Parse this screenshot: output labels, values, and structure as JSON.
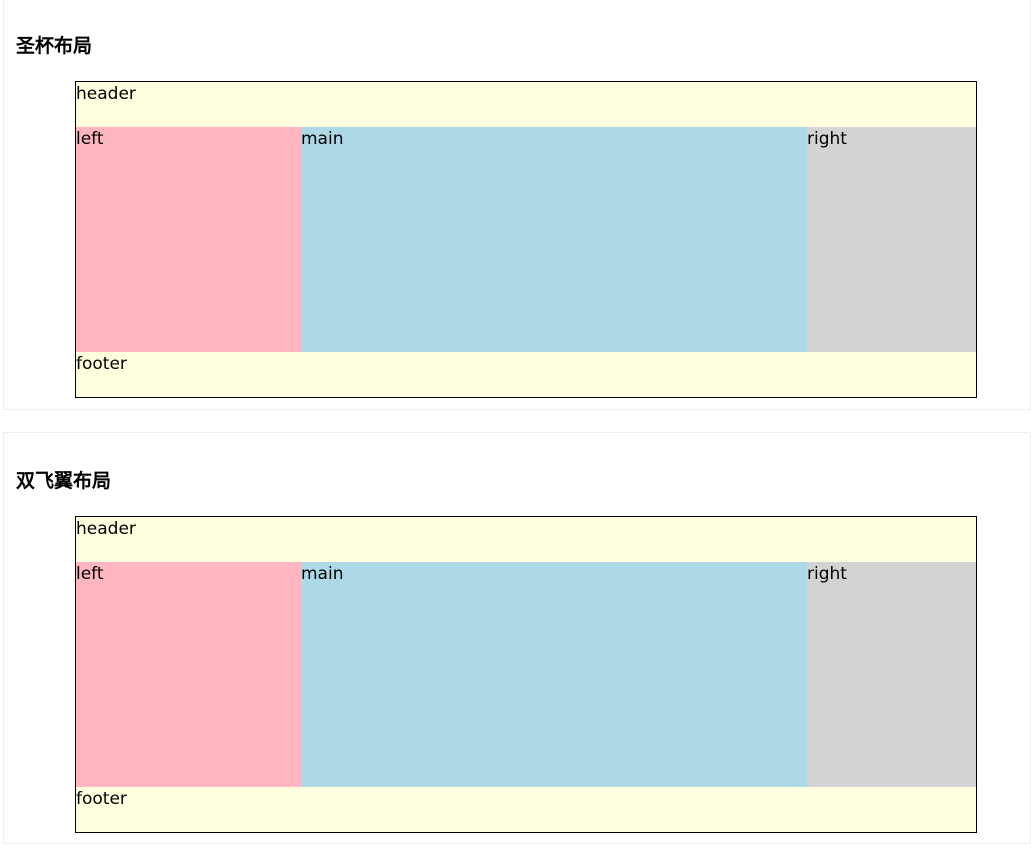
{
  "sections": [
    {
      "title": "圣杯布局",
      "regions": {
        "header": "header",
        "left": "left",
        "main": "main",
        "right": "right",
        "footer": "footer"
      }
    },
    {
      "title": "双飞翼布局",
      "regions": {
        "header": "header",
        "left": "left",
        "main": "main",
        "right": "right",
        "footer": "footer"
      }
    }
  ],
  "colors": {
    "header_footer": "#ffffe0",
    "left": "#ffb6c1",
    "main": "#add8e6",
    "right": "#d3d3d3",
    "border": "#000000"
  }
}
